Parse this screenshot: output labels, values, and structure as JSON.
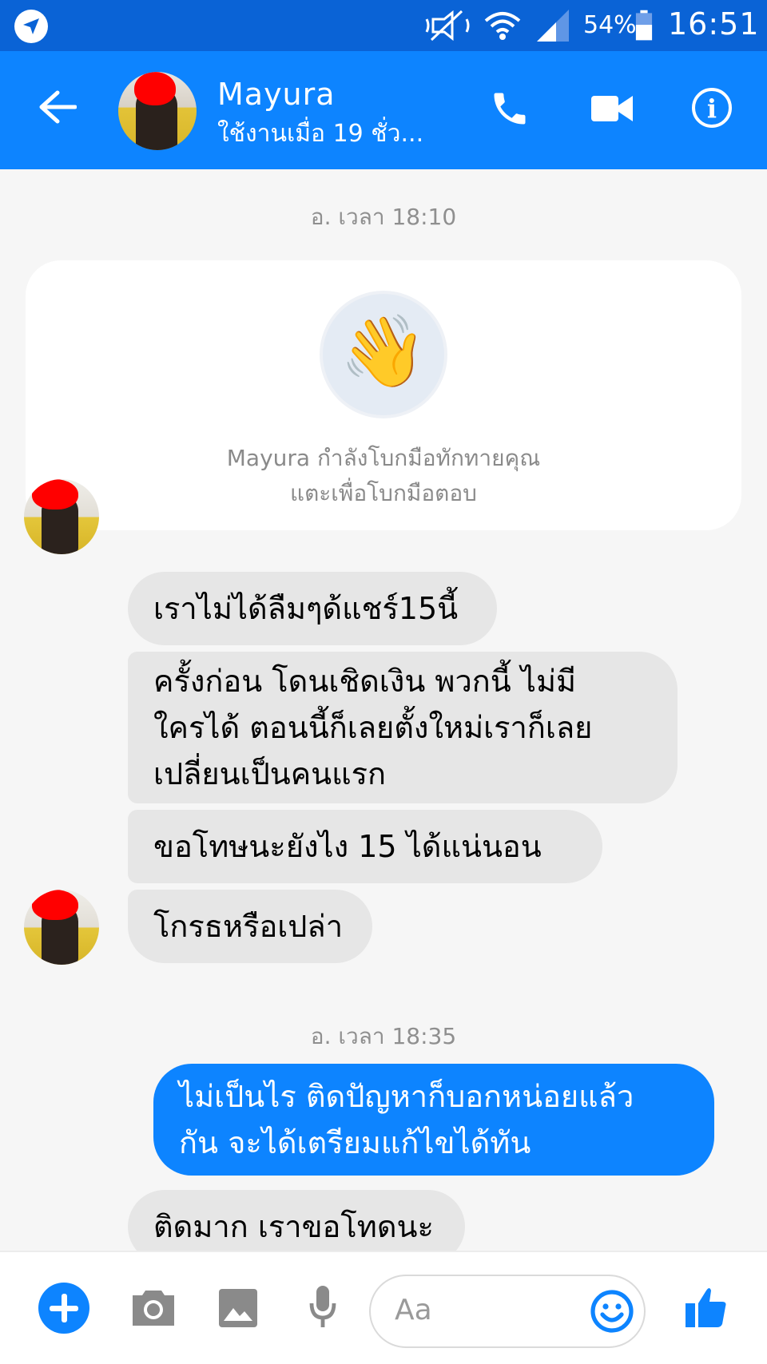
{
  "status_bar": {
    "battery": "54%",
    "time": "16:51"
  },
  "header": {
    "contact_name": "Mayura",
    "active_status": "ใช้งานเมื่อ 19 ชั่ว..."
  },
  "messages": {
    "timestamp_1": "อ. เวลา 18:10",
    "wave_line_1": "Mayura กำลังโบกมือทักทายคุณ",
    "wave_line_2": "แตะเพื่อโบกมือตอบ",
    "in_1": "เราไม่ได้ลืมๆด้แชร์15นี้",
    "in_2_line_1": "ครั้งก่อน  โดนเชิดเงิน  พวกนี้  ไม่มี",
    "in_2_line_2": "ใครได้  ตอนนี้ก็เลยตั้งใหม่เราก็เลย",
    "in_2_line_3": "เปลี่ยนเป็นคนแรก",
    "in_3": "ขอโทษนะยังไง 15 ได้แน่นอน",
    "in_4": "โกรธหรือเปล่า",
    "timestamp_2": "อ. เวลา 18:35",
    "out_1_line_1": "ไม่เป็นไร ติดปัญหาก็บอกหน่อยแล้ว",
    "out_1_line_2": "กัน จะได้เตรียมแก้ไขได้ทัน",
    "in_5": "ติดมาก เราขอโทดนะ"
  },
  "composer": {
    "placeholder": "Aa"
  },
  "colors": {
    "status_bar": "#0a63d6",
    "app_bar": "#0d84ff",
    "incoming_bubble": "#e6e6e6",
    "outgoing_bubble": "#0d84ff"
  }
}
